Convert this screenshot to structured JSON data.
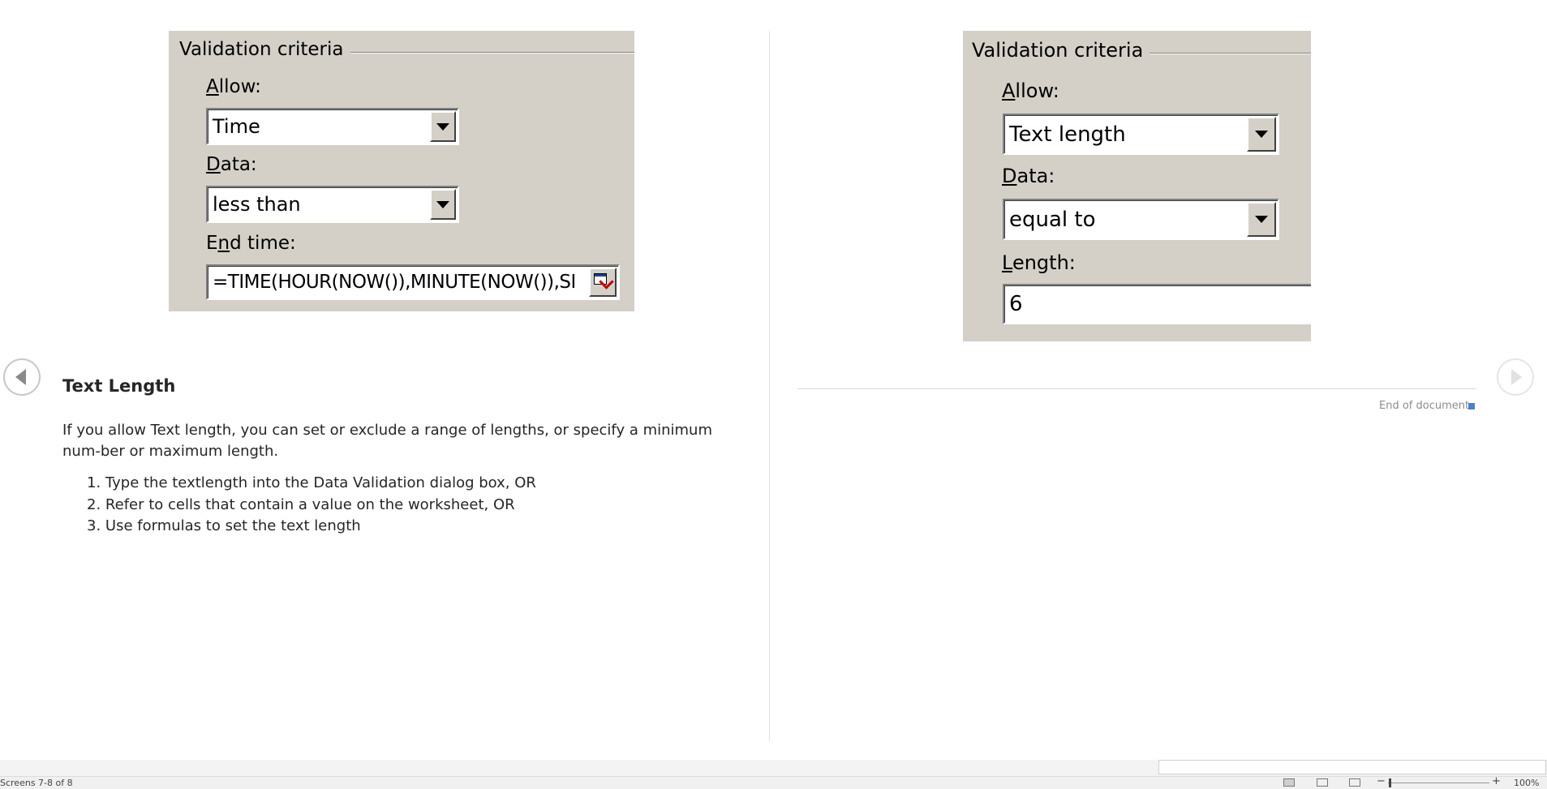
{
  "left_dialog": {
    "group_title": "Validation criteria",
    "allow_label_ul": "A",
    "allow_label_rest": "llow:",
    "allow_value": "Time",
    "data_label_ul": "D",
    "data_label_rest": "ata:",
    "data_value": "less than",
    "end_label_pre": "E",
    "end_label_ul": "n",
    "end_label_rest": "d time:",
    "end_value": "=TIME(HOUR(NOW()),MINUTE(NOW()),SI"
  },
  "right_dialog": {
    "group_title": "Validation criteria",
    "allow_label_ul": "A",
    "allow_label_rest": "llow:",
    "allow_value": "Text length",
    "data_label_ul": "D",
    "data_label_rest": "ata:",
    "data_value": "equal to",
    "length_label_ul": "L",
    "length_label_rest": "ength:",
    "length_value": "6"
  },
  "document": {
    "heading": "Text Length",
    "paragraph": "If you allow Text length, you can set or exclude a range of lengths, or specify a minimum num-ber or maximum length.",
    "list": [
      {
        "number": "1.",
        "text": "Type the textlength into the Data Validation dialog box, OR"
      },
      {
        "number": "2.",
        "text": "Refer to cells that contain a value on the worksheet, OR"
      },
      {
        "number": "3.",
        "text": "Use formulas to set the text length"
      }
    ],
    "end_of_document": "End of document"
  },
  "status": {
    "screens": "Screens 7-8 of 8",
    "zoom_minus": "−",
    "zoom_plus": "+",
    "zoom_level": "100%"
  },
  "icons": {
    "prev": "chevron-left-icon",
    "next": "chevron-right-icon",
    "dropdown": "triangle-down-icon",
    "collapse": "collapse-dialog-icon"
  },
  "colors": {
    "dialog_bg": "#d4d0c8",
    "end_marker": "#4f7fc4"
  }
}
